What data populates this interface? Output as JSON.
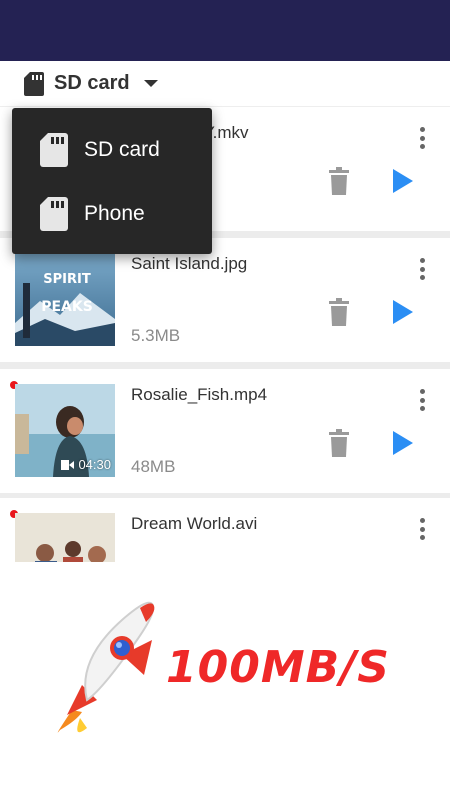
{
  "storage": {
    "selected": "SD card"
  },
  "dropdown": {
    "options": [
      "SD card",
      "Phone"
    ]
  },
  "files": [
    {
      "name": "Sound of Y.mkv",
      "size": "",
      "dot": false,
      "duration": ""
    },
    {
      "name": "Saint Island.jpg",
      "size": "5.3MB",
      "dot": false,
      "duration": "",
      "thumb_title": "SPIRIT OF THE PEAKS"
    },
    {
      "name": "Rosalie_Fish.mp4",
      "size": "48MB",
      "dot": true,
      "duration": "04:30"
    },
    {
      "name": "Dream World.avi",
      "size": "",
      "dot": true,
      "duration": ""
    }
  ],
  "promo": {
    "speed": "100MB/S"
  },
  "colors": {
    "header": "#242253",
    "play": "#2b8ef4",
    "promo_text": "#ef2828",
    "dot": "#e8161b"
  }
}
